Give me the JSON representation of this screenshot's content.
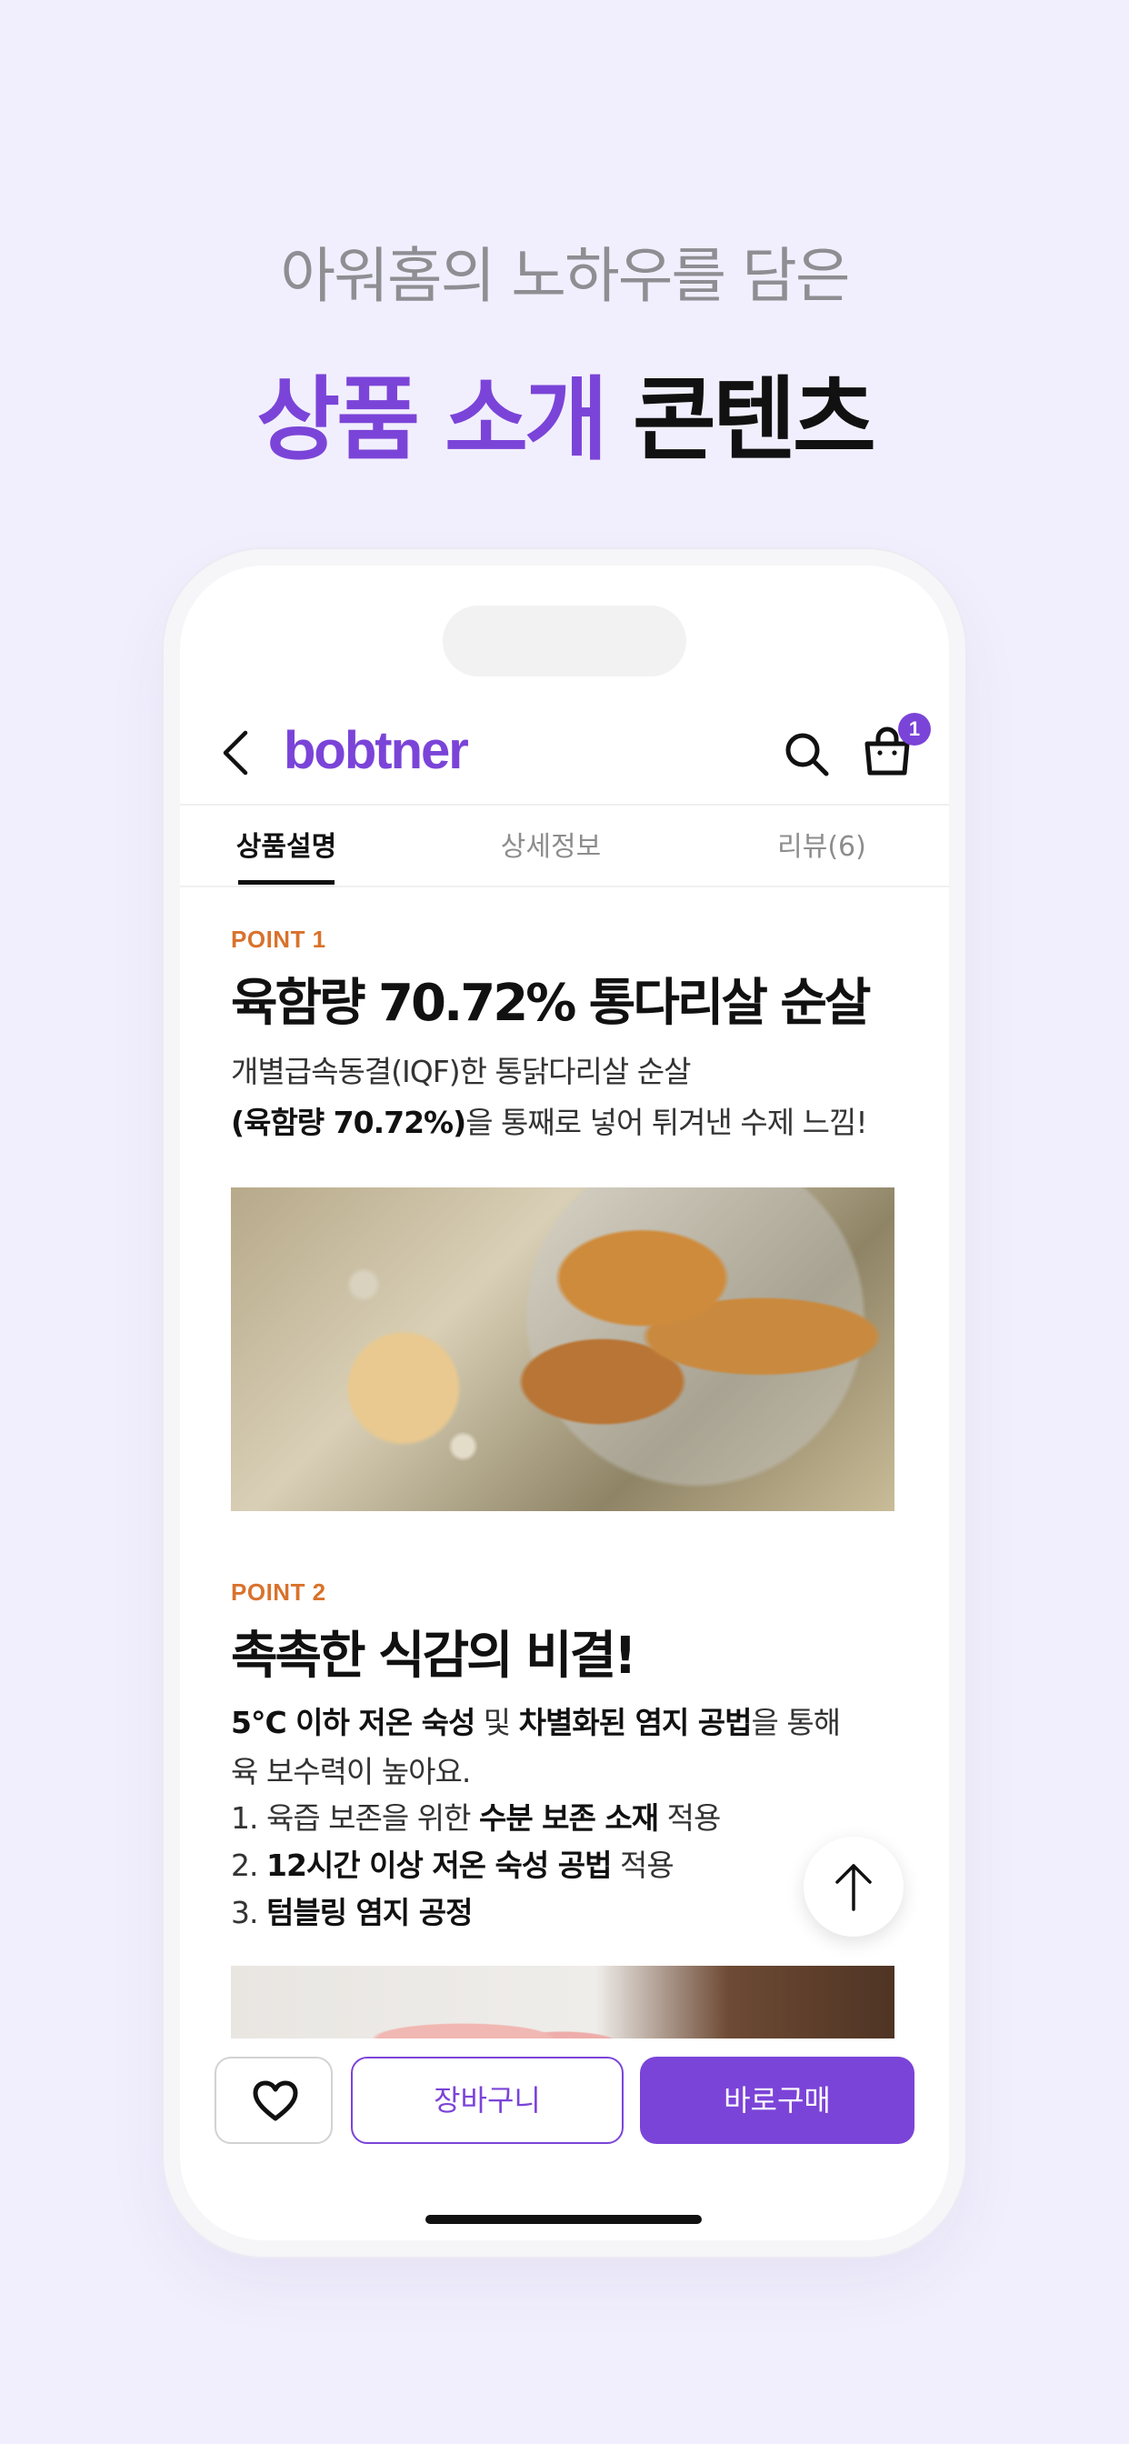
{
  "promo": {
    "subtitle": "아워홈의 노하우를 담은",
    "title_accent": "상품 소개",
    "title_rest": " 콘텐츠"
  },
  "appbar": {
    "logo": "bobtner",
    "cart_count": "1"
  },
  "tabs": [
    {
      "label": "상품설명",
      "active": true
    },
    {
      "label": "상세정보",
      "active": false
    },
    {
      "label": "리뷰(6)",
      "active": false
    }
  ],
  "point1": {
    "label": "POINT 1",
    "title": "육함량 70.72% 통다리살 순살",
    "line1": "개별급속동결(IQF)한 통닭다리살 순살",
    "line2_bold": "(육함량 70.72%)",
    "line2_rest": "을 통째로 넣어 튀겨낸 수제 느낌!"
  },
  "point2": {
    "label": "POINT 2",
    "title": "촉촉한 식감의 비결!",
    "line1_bold1": "5°C 이하 저온 숙성",
    "line1_mid": " 및 ",
    "line1_bold2": "차별화된 염지 공법",
    "line1_rest": "을 통해",
    "line2": "육 보수력이 높아요.",
    "list": [
      {
        "prefix": "1. 육즙 보존을 위한 ",
        "bold": "수분 보존 소재",
        "suffix": " 적용"
      },
      {
        "prefix": "2. ",
        "bold": "12시간 이상 저온 숙성 공법",
        "suffix": " 적용"
      },
      {
        "prefix": "3. ",
        "bold": "텀블링 염지 공정",
        "suffix": ""
      }
    ]
  },
  "bottom": {
    "cart_label": "장바구니",
    "buy_label": "바로구매"
  },
  "colors": {
    "accent": "#7b44d8",
    "point_label": "#d9722c",
    "background": "#f1effd"
  }
}
